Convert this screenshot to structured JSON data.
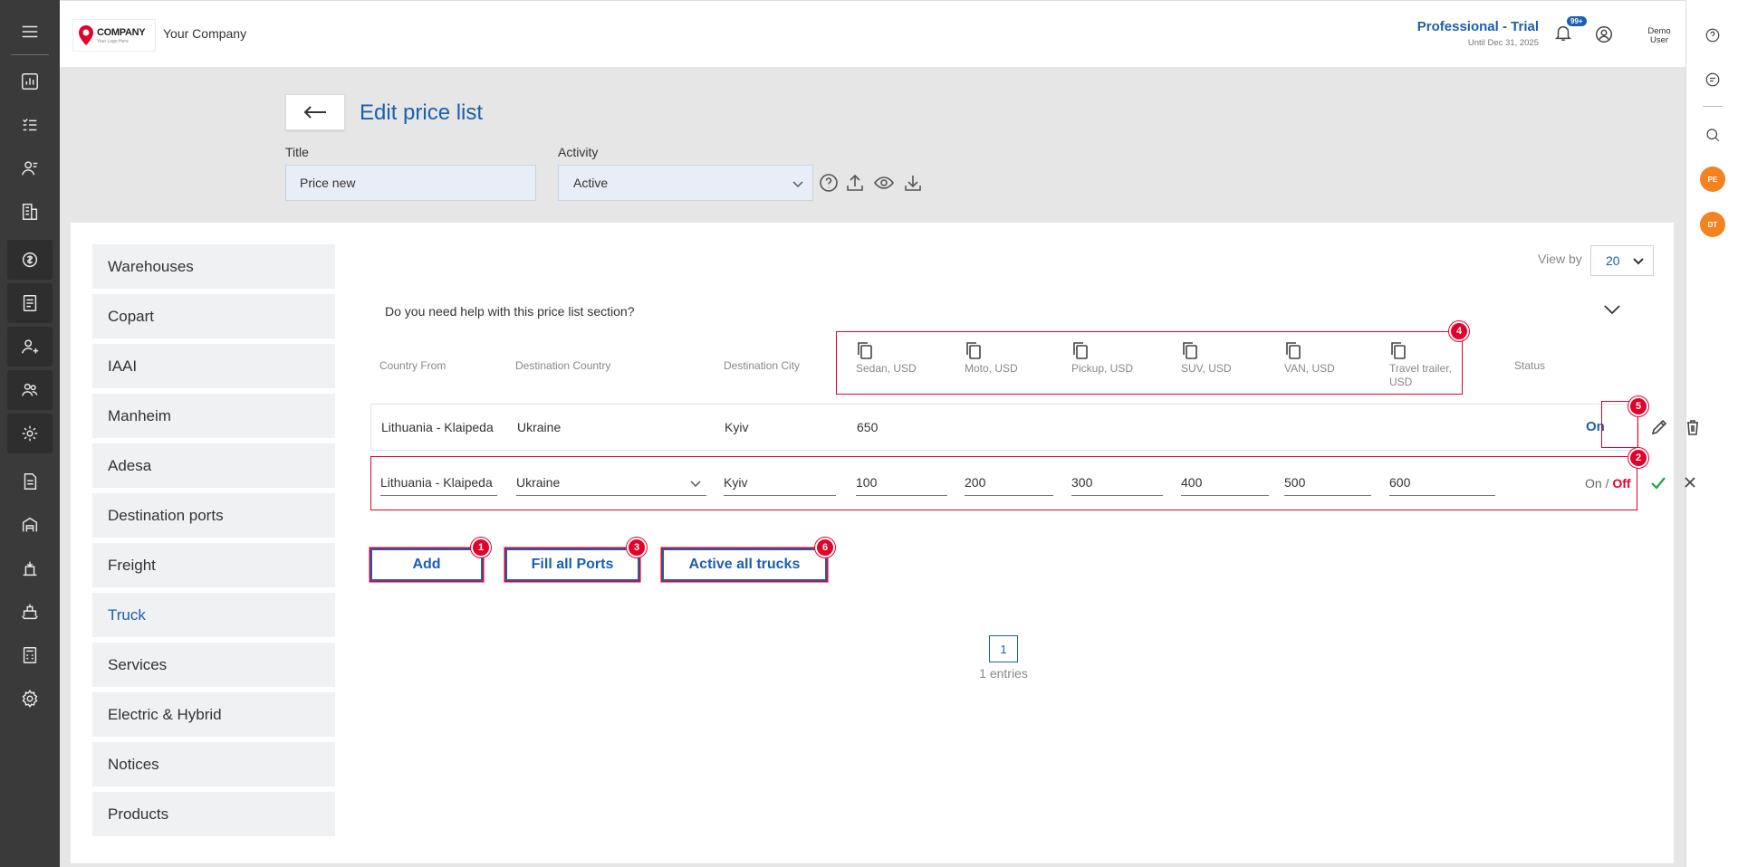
{
  "header": {
    "logo_title": "COMPANY",
    "logo_sub": "Your Logo Here",
    "company_name": "Your Company",
    "plan_title": "Professional - Trial",
    "plan_until": "Until Dec 31, 2025",
    "notifications_badge": "99+",
    "user_name": "Demo User"
  },
  "right_bar": {
    "avatar_1": "PE",
    "avatar_2": "DT"
  },
  "page": {
    "title": "Edit price list",
    "title_label": "Title",
    "title_value": "Price new",
    "activity_label": "Activity",
    "activity_value": "Active"
  },
  "categories": [
    {
      "label": "Warehouses"
    },
    {
      "label": "Copart"
    },
    {
      "label": "IAAI"
    },
    {
      "label": "Manheim"
    },
    {
      "label": "Adesa"
    },
    {
      "label": "Destination ports"
    },
    {
      "label": "Freight"
    },
    {
      "label": "Truck"
    },
    {
      "label": "Services"
    },
    {
      "label": "Electric & Hybrid"
    },
    {
      "label": "Notices"
    },
    {
      "label": "Products"
    }
  ],
  "active_category": "Truck",
  "viewby": {
    "label": "View by",
    "value": "20"
  },
  "help": {
    "text": "Do you need help with this price list section?"
  },
  "table": {
    "columns": {
      "country_from": "Country From",
      "destination_country": "Destination Country",
      "destination_city": "Destination City",
      "sedan": "Sedan, USD",
      "moto": "Moto, USD",
      "pickup": "Pickup, USD",
      "suv": "SUV, USD",
      "van": "VAN, USD",
      "travel_trailer": "Travel trailer, USD",
      "status": "Status"
    },
    "row1": {
      "country_from": "Lithuania - Klaipeda",
      "destination_country": "Ukraine",
      "destination_city": "Kyiv",
      "sedan": "650",
      "status": "On"
    },
    "row2": {
      "country_from": "Lithuania - Klaipeda",
      "destination_country": "Ukraine",
      "destination_city": "Kyiv",
      "sedan": "100",
      "moto": "200",
      "pickup": "300",
      "suv": "400",
      "van": "500",
      "travel_trailer": "600",
      "status_on": "On /",
      "status_off": "Off"
    }
  },
  "actions": {
    "add": "Add",
    "fill_ports": "Fill all Ports",
    "active_trucks": "Active all trucks"
  },
  "markers": [
    "1",
    "2",
    "3",
    "4",
    "5",
    "6"
  ],
  "pagination": {
    "page": "1",
    "entries": "1 entries"
  },
  "colors": {
    "accent": "#1b5fae",
    "highlight": "#e4002b",
    "sidebar": "#3a3a3a",
    "avatar": "#f58220",
    "confirm": "#1aa34a"
  }
}
